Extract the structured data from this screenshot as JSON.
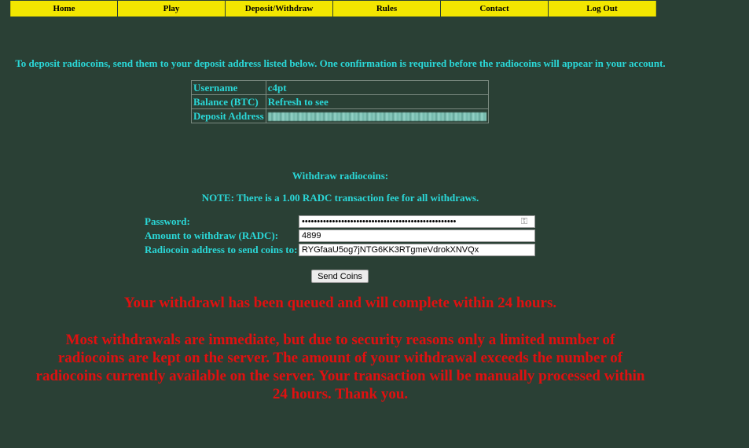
{
  "nav": {
    "items": [
      {
        "label": "Home"
      },
      {
        "label": "Play"
      },
      {
        "label": "Deposit/Withdraw"
      },
      {
        "label": "Rules"
      },
      {
        "label": "Contact"
      },
      {
        "label": "Log Out"
      }
    ]
  },
  "intro_text": "To deposit radiocoins, send them to your deposit address listed below. One confirmation is required before the radiocoins will appear in your account.",
  "account": {
    "username_label": "Username",
    "username_value": "c4pt",
    "balance_label": "Balance (BTC)",
    "balance_value": "Refresh to see",
    "deposit_label": "Deposit Address",
    "deposit_value_redacted": true
  },
  "withdraw": {
    "title": "Withdraw radiocoins:",
    "note": "NOTE: There is a 1.00 RADC transaction fee for all withdraws.",
    "password_label": "Password:",
    "password_value": "•••••••••••••••••••••••••••••••••••••••••••••••••••",
    "amount_label": "Amount to withdraw (RADC):",
    "amount_value": "4899",
    "address_label": "Radiocoin address to send coins to:",
    "address_value": "RYGfaaU5og7jNTG6KK3RTgmeVdrokXNVQx",
    "send_label": "Send Coins"
  },
  "messages": {
    "queued": "Your withdrawl has been queued and will complete within 24 hours.",
    "details": "Most withdrawals are immediate, but due to security reasons only a limited number of radiocoins are kept on the server. The amount of your withdrawal exceeds the number of radiocoins currently available on the server. Your transaction will be manually processed within 24 hours. Thank you."
  },
  "colors": {
    "background": "#2a4035",
    "nav_bg": "#f2e600",
    "text_cyan": "#2ad8d8",
    "message_red": "#e01010"
  }
}
